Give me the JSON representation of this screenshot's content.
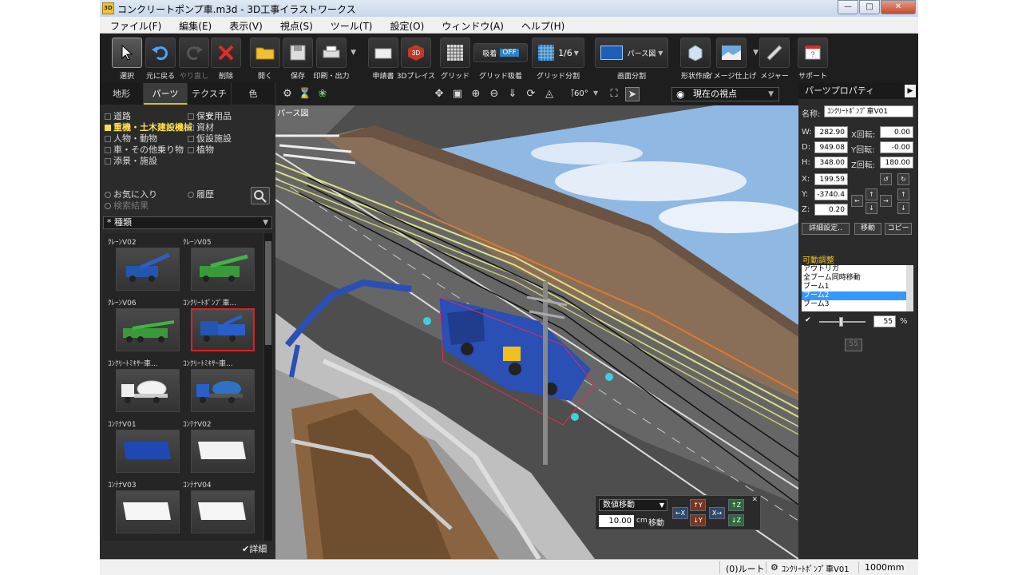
{
  "window": {
    "title": "コンクリートポンプ車.m3d - 3D工事イラストワークス",
    "app_icon": "3D"
  },
  "menu": [
    "ファイル(F)",
    "編集(E)",
    "表示(V)",
    "視点(S)",
    "ツール(T)",
    "設定(O)",
    "ウィンドウ(A)",
    "ヘルプ(H)"
  ],
  "toolbar": {
    "select": "選択",
    "undo": "元に戻る",
    "redo": "やり直し",
    "delete": "削除",
    "open": "開く",
    "save": "保存",
    "print": "印刷・出力",
    "estimate": "申請書",
    "place3d": "3Dプレイス",
    "grid": "グリッド",
    "snap_label": "吸着",
    "snap_state": "OFF",
    "grid_snap": "グリッド吸着",
    "grid_div_value": "1/6",
    "grid_div": "グリッド分割",
    "view_mode": "パース図",
    "screen_split": "画面分割",
    "shape": "形状作成",
    "image_finish": "イメージ仕上げ",
    "measure": "メジャー",
    "support": "サポート"
  },
  "left_panel": {
    "tabs": [
      "地形",
      "パーツ",
      "テクスチャ",
      "色"
    ],
    "categories_col1": [
      "道路",
      "重機・土木建設機械",
      "人物・動物",
      "車・その他乗り物",
      "添景・施設"
    ],
    "categories_col2": [
      "保安用品",
      "資材",
      "仮設施設",
      "植物"
    ],
    "favorites": "お気に入り",
    "history": "履歴",
    "search_results": "検索結果",
    "kind_filter": "* 種類",
    "detail": "詳細",
    "thumbnails": [
      {
        "name": "ｸﾚｰﾝV02"
      },
      {
        "name": "ｸﾚｰﾝV05"
      },
      {
        "name": "ｸﾚｰﾝV06"
      },
      {
        "name": "ｺﾝｸﾘｰﾄﾎﾟﾝﾌﾟ車..."
      },
      {
        "name": "ｺﾝｸﾘｰﾄﾐｷｻｰ車..."
      },
      {
        "name": "ｺﾝｸﾘｰﾄﾐｷｻｰ車..."
      },
      {
        "name": "ｺﾝﾃﾅV01"
      },
      {
        "name": "ｺﾝﾃﾅV02"
      },
      {
        "name": "ｺﾝﾃﾅV03"
      },
      {
        "name": "ｺﾝﾃﾅV04"
      }
    ]
  },
  "viewport": {
    "label": "パース図",
    "view_angle": "60°",
    "camera": "現在の視点",
    "move_panel": {
      "mode": "数値移動",
      "value": "10.00",
      "unit": "cm",
      "move_label": "移動"
    }
  },
  "right_panel": {
    "title": "パーツプロパティ",
    "name_label": "名称:",
    "name_value": "ｺﾝｸﾘｰﾄﾎﾟﾝﾌﾟ車V01",
    "W": "282.90",
    "D": "949.08",
    "H": "348.00",
    "X": "199.59",
    "Y": "-3740.4",
    "Z": "0.20",
    "x_rot_label": "X回転:",
    "x_rot": "0.00",
    "y_rot_label": "Y回転:",
    "y_rot": "-0.00",
    "z_rot_label": "Z回転:",
    "z_rot": "180.00",
    "detail_btn": "詳細設定..",
    "move_btn": "移動",
    "copy_btn": "コピー",
    "joint_section": "可動調整",
    "joints": [
      "アウトリガ",
      "全ブーム同時移動",
      "ブーム1",
      "ブーム2",
      "ブーム3"
    ],
    "slider_value": "55",
    "percent": "%",
    "disabled_value": "55"
  },
  "statusbar": {
    "route": "(0)ルート",
    "part": "ｺﾝｸﾘｰﾄﾎﾟﾝﾌﾟ車V01",
    "scale": "1000mm"
  }
}
